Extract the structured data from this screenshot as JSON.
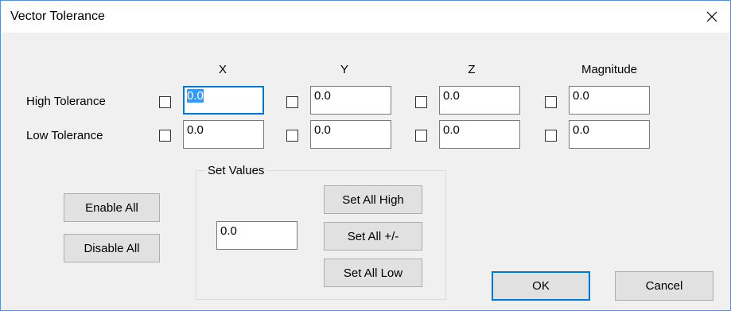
{
  "window": {
    "title": "Vector Tolerance",
    "close_glyph": "✕"
  },
  "columns": [
    "X",
    "Y",
    "Z",
    "Magnitude"
  ],
  "rows": {
    "high": {
      "label": "High Tolerance",
      "values": [
        "0.0",
        "0.0",
        "0.0",
        "0.0"
      ],
      "checked": [
        false,
        false,
        false,
        false
      ]
    },
    "low": {
      "label": "Low Tolerance",
      "values": [
        "0.0",
        "0.0",
        "0.0",
        "0.0"
      ],
      "checked": [
        false,
        false,
        false,
        false
      ]
    }
  },
  "buttons": {
    "enable_all": "Enable All",
    "disable_all": "Disable All",
    "set_all_high": "Set All High",
    "set_all_pm": "Set All +/-",
    "set_all_low": "Set All Low",
    "ok": "OK",
    "cancel": "Cancel"
  },
  "set_values": {
    "title": "Set Values",
    "value": "0.0"
  },
  "colors": {
    "focus_accent": "#0078d7",
    "selection": "#3399ff",
    "window_border": "#5b8fd1"
  }
}
